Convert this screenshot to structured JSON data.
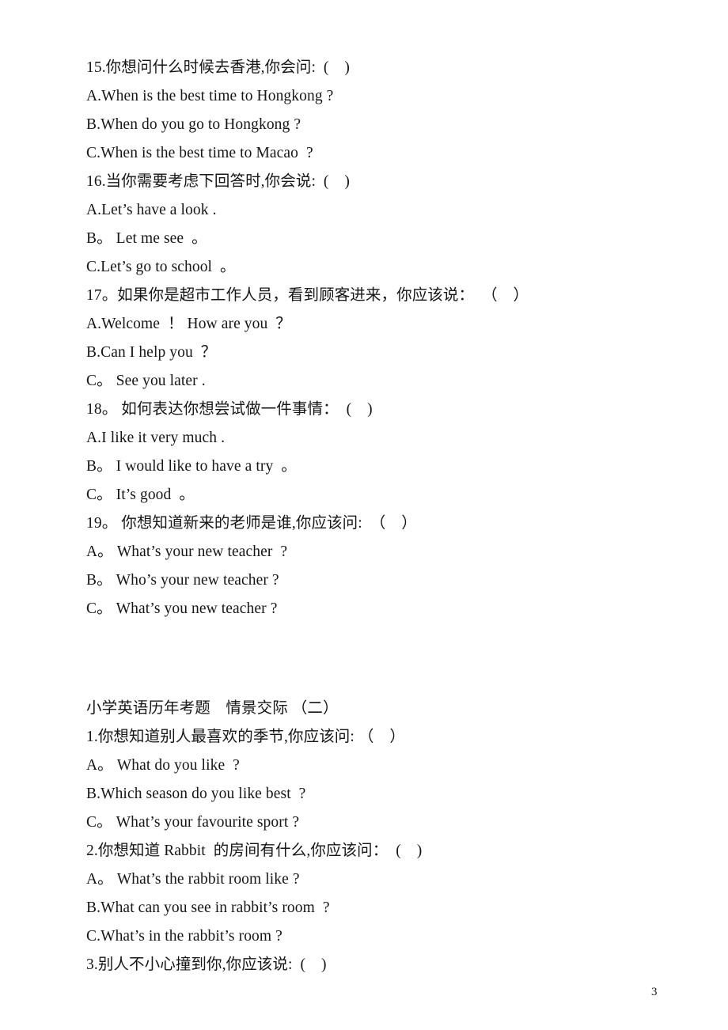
{
  "document": {
    "page_number": "3",
    "blocks": [
      {
        "kind": "stem",
        "text": "15.你想问什么时候去香港,你会问:  (    )"
      },
      {
        "kind": "option",
        "text": "A.When is the best time to Hongkong ?"
      },
      {
        "kind": "option",
        "text": "B.When do you go to Hongkong ?"
      },
      {
        "kind": "option",
        "text": "C.When is the best time to Macao  ?"
      },
      {
        "kind": "stem",
        "text": "16.当你需要考虑下回答时,你会说:  (    )"
      },
      {
        "kind": "option",
        "text": "A.Let’s have a look ."
      },
      {
        "kind": "option",
        "text": "B。 Let me see  。"
      },
      {
        "kind": "option",
        "text": "C.Let’s go to school  。"
      },
      {
        "kind": "stem",
        "text": "17。如果你是超市工作人员，看到顾客进来，你应该说：  （    ）"
      },
      {
        "kind": "option",
        "text": "A.Welcome  ！ How are you  ？"
      },
      {
        "kind": "option",
        "text": "B.Can I help you  ？"
      },
      {
        "kind": "option",
        "text": "C。 See you later ."
      },
      {
        "kind": "stem",
        "text": "18。 如何表达你想尝试做一件事情：  (    )"
      },
      {
        "kind": "option",
        "text": "A.I like it very much ."
      },
      {
        "kind": "option",
        "text": "B。 I would like to have a try  。"
      },
      {
        "kind": "option",
        "text": "C。 It’s good  。"
      },
      {
        "kind": "stem",
        "text": "19。 你想知道新来的老师是谁,你应该问:  （    ）"
      },
      {
        "kind": "option",
        "text": "A。 What’s your new teacher  ?"
      },
      {
        "kind": "option",
        "text": "B。 Who’s your new teacher ?"
      },
      {
        "kind": "option",
        "text": "C。 What’s you new teacher ?"
      },
      {
        "kind": "spacer",
        "text": ""
      },
      {
        "kind": "spacer",
        "text": ""
      },
      {
        "kind": "spacer-half",
        "text": ""
      },
      {
        "kind": "heading",
        "text": "小学英语历年考题　情景交际 （二）"
      },
      {
        "kind": "stem",
        "text": "1.你想知道别人最喜欢的季节,你应该问: （    ）"
      },
      {
        "kind": "option",
        "text": "A。 What do you like  ?"
      },
      {
        "kind": "option",
        "text": "B.Which season do you like best  ?"
      },
      {
        "kind": "option",
        "text": "C。 What’s your favourite sport ?"
      },
      {
        "kind": "stem",
        "text": "2.你想知道 Rabbit  的房间有什么,你应该问：  (    )"
      },
      {
        "kind": "option",
        "text": "A。 What’s the rabbit room like ?"
      },
      {
        "kind": "option",
        "text": "B.What can you see in rabbit’s room  ?"
      },
      {
        "kind": "option",
        "text": "C.What’s in the rabbit’s room ?"
      },
      {
        "kind": "stem",
        "text": "3.别人不小心撞到你,你应该说:  (    )"
      }
    ]
  }
}
